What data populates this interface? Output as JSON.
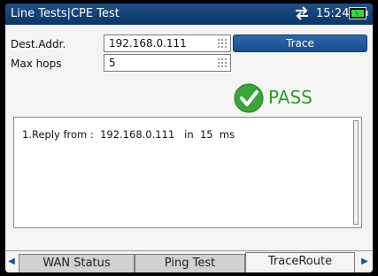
{
  "header": {
    "title": "Line Tests|CPE Test",
    "time": "15:24",
    "network_icon": "network-transfer-icon",
    "battery_icon": "battery-icon"
  },
  "form": {
    "dest_label": "Dest.Addr.",
    "dest_value": "192.168.0.111",
    "hops_label": "Max hops",
    "hops_value": "5",
    "trace_button": "Trace"
  },
  "status": {
    "text": "PASS",
    "icon": "check-icon",
    "color": "#2e9b2e"
  },
  "results": {
    "lines": [
      "1.Reply from :  192.168.0.111   in  15  ms"
    ]
  },
  "tabs": [
    {
      "label": "WAN Status",
      "active": false
    },
    {
      "label": "Ping Test",
      "active": false
    },
    {
      "label": "TraceRoute",
      "active": true
    }
  ]
}
